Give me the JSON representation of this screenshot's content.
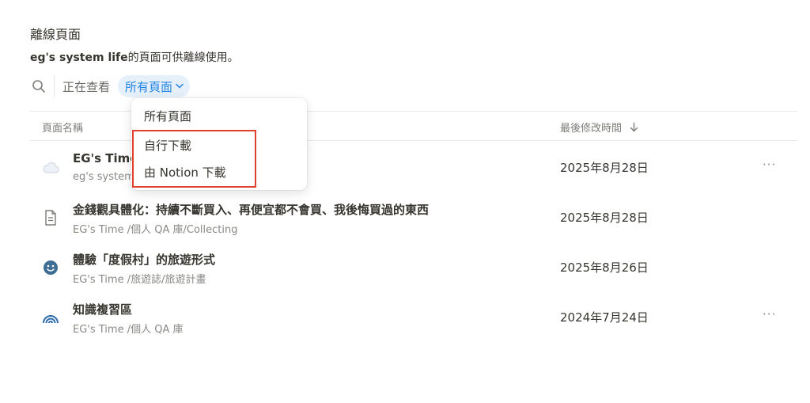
{
  "header": {
    "title": "離線頁面",
    "workspace_name": "eg's system life",
    "description_suffix": "的頁面可供離線使用。"
  },
  "filter": {
    "viewing_label": "正在查看",
    "selected": "所有頁面"
  },
  "table": {
    "col_name": "頁面名稱",
    "col_modified": "最後修改時間",
    "sort_icon": "arrow-down"
  },
  "rows": [
    {
      "icon": "cloud-icon",
      "name": "EG's Time",
      "path": "eg's system life",
      "date": "2025年8月28日",
      "more": "···"
    },
    {
      "icon": "document-icon",
      "name": "金錢觀具體化：持續不斷買入、再便宜都不會買、我後悔買過的東西",
      "path": "EG's Time /個人 QA 庫/Collecting",
      "date": "2025年8月28日"
    },
    {
      "icon": "smiley-icon",
      "name": "體驗「度假村」的旅遊形式",
      "path": "EG's Time /旅遊誌/旅遊計畫",
      "date": "2025年8月26日"
    },
    {
      "icon": "rainbow-icon",
      "name": "知識複習區",
      "path": "EG's Time /個人 QA 庫",
      "date": "2024年7月24日",
      "more": "···"
    }
  ],
  "dropdown": {
    "options": [
      "所有頁面",
      "自行下載",
      "由 Notion 下載"
    ]
  },
  "colors": {
    "accent": "#2383e2",
    "pill_bg": "#e6f0fb",
    "highlight_border": "#e0412e"
  }
}
